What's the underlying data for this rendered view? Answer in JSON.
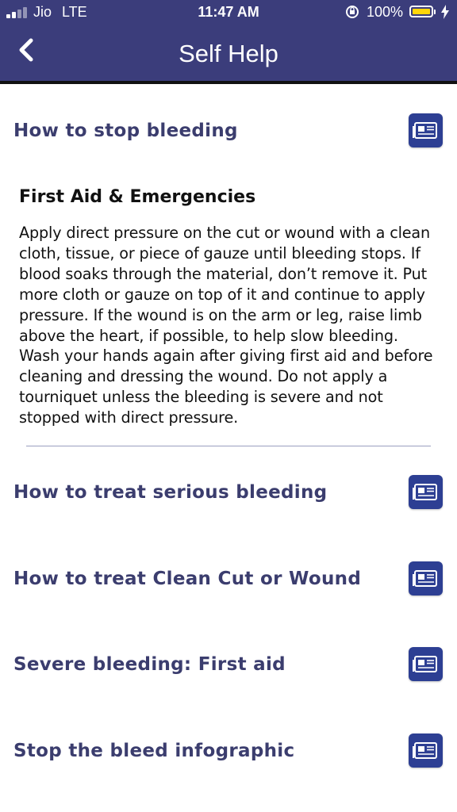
{
  "status_bar": {
    "carrier": "Jio",
    "network": "LTE",
    "time": "11:47 AM",
    "battery": "100%",
    "battery_level": 1.0
  },
  "header": {
    "title": "Self Help",
    "back_icon": "chevron-left-icon"
  },
  "items": [
    {
      "title": "How to stop bleeding",
      "icon": "newspaper-icon"
    },
    {
      "title": "How to treat serious bleeding",
      "icon": "newspaper-icon"
    },
    {
      "title": "How to treat Clean Cut or Wound",
      "icon": "newspaper-icon"
    },
    {
      "title": "Severe bleeding: First aid",
      "icon": "newspaper-icon"
    },
    {
      "title": "Stop the bleed infographic",
      "icon": "newspaper-icon"
    }
  ],
  "expanded": {
    "heading": "First Aid & Emergencies",
    "body": "Apply direct pressure on the cut or wound with a clean cloth, tissue, or piece of gauze until bleeding stops. If blood soaks through the material, don’t remove it. Put more cloth or gauze on top of it and continue to apply pressure. If the wound is on the arm or leg, raise limb above the heart, if possible, to help slow bleeding. Wash your hands again after giving first aid and before cleaning and dressing the wound. Do not apply a tourniquet unless the bleeding is severe and not stopped with direct pressure."
  },
  "colors": {
    "header_bg": "#3b3d7b",
    "title_text": "#3b3d6e",
    "icon_bg": "#2d3f93",
    "battery": "#ffd60a"
  }
}
